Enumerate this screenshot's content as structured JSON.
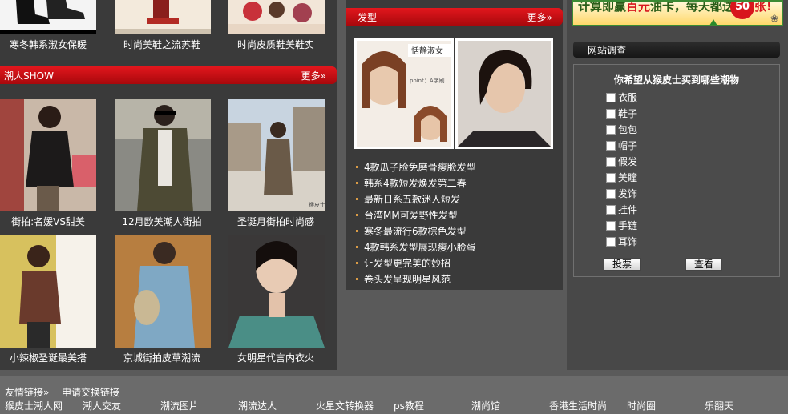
{
  "top_row": {
    "captions": [
      "寒冬韩系淑女保暖",
      "时尚美鞋之流苏鞋",
      "时尚皮质鞋美鞋实"
    ]
  },
  "chao_ren": {
    "title": "潮人SHOW",
    "more": "更多»",
    "row1": [
      "街拍:名媛VS甜美",
      "12月欧美潮人街拍",
      "圣诞月街拍时尚感"
    ],
    "row2": [
      "小辣椒圣诞最美搭",
      "京城街拍皮草潮流",
      "女明星代言内衣火"
    ]
  },
  "hair": {
    "title": "发型",
    "more": "更多»",
    "image_text_1": "恬静淑女",
    "image_text_2": "point：A字刷",
    "articles": [
      "4款瓜子脸免磨骨瘦脸发型",
      "韩系4款短发焕发第二春",
      "最新日系五款迷人短发",
      "台湾MM可爱野性发型",
      "寒冬最流行6款棕色发型",
      "4款韩系发型展现瘦小脸蛋",
      "让发型更完美的妙招",
      "卷头发呈现明星风范"
    ]
  },
  "banner": {
    "text_a": "计算即赢",
    "text_b": "百元",
    "text_c": "油卡，每天都送",
    "badge": "50",
    "text_d": "张!"
  },
  "survey": {
    "title": "网站调查",
    "question": "你希望从猴皮士买到哪些潮物",
    "options": [
      "衣服",
      "鞋子",
      "包包",
      "帽子",
      "假发",
      "美瞳",
      "发饰",
      "挂件",
      "手链",
      "耳饰"
    ],
    "vote": "投票",
    "view": "查看"
  },
  "footer": {
    "friend_links": "友情链接»",
    "apply": "申请交换链接",
    "links": [
      "猴皮士潮人网",
      "潮人交友",
      "潮流图片",
      "潮流达人",
      "火星文转换器",
      "ps教程",
      "潮尚馆",
      "香港生活时尚",
      "时尚圈",
      "乐翻天"
    ]
  },
  "colors": {
    "accent_red": "#d0121a",
    "panel_dark": "#3a3a3a",
    "page_gray": "#5a5a5a"
  }
}
